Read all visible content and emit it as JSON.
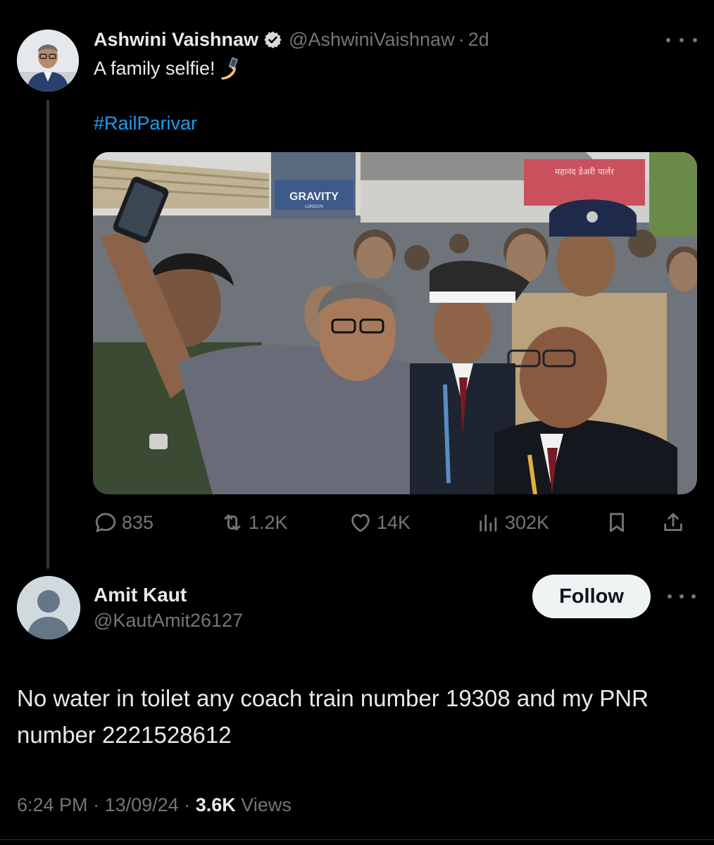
{
  "parent_tweet": {
    "author_name": "Ashwini Vaishnaw",
    "handle": "@AshwiniVaishnaw",
    "separator": "·",
    "time": "2d",
    "text": "A family selfie!",
    "emoji_icon": "selfie-icon",
    "hashtag": "#RailParivar",
    "photo_signs": {
      "billboard_brand": "GRAVITY",
      "billboard_sub": "LONDON",
      "shop_sign": "महानंद डेअरी पार्लर"
    },
    "stats": {
      "replies": "835",
      "reposts": "1.2K",
      "likes": "14K",
      "views": "302K"
    }
  },
  "reply": {
    "author_name": "Amit Kaut",
    "handle": "@KautAmit26127",
    "follow_label": "Follow",
    "text": "No water in toilet  any coach train number 19308 and my PNR number 2221528612",
    "time": "6:24 PM",
    "date": "13/09/24",
    "separator": "·",
    "views_count": "3.6K",
    "views_label": "Views"
  },
  "colors": {
    "background": "#000000",
    "text_primary": "#e7e9ea",
    "text_secondary": "#71767b",
    "link": "#1d9bf0",
    "verified_badge": "#d9d9d9",
    "thread_line": "#333639"
  }
}
